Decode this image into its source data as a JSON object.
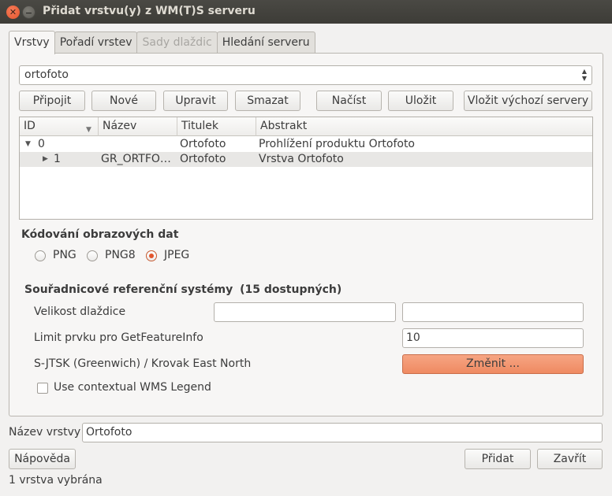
{
  "window": {
    "title": "Přidat vrstvu(y) z WM(T)S serveru"
  },
  "tabs": [
    {
      "label": "Vrstvy",
      "state": "active"
    },
    {
      "label": "Pořadí vrstev",
      "state": "normal"
    },
    {
      "label": "Sady dlaždic",
      "state": "disabled"
    },
    {
      "label": "Hledání serveru",
      "state": "normal"
    }
  ],
  "connection": {
    "selected": "ortofoto"
  },
  "connection_buttons": {
    "connect": "Připojit",
    "new": "Nové",
    "edit": "Upravit",
    "delete": "Smazat",
    "load": "Načíst",
    "save": "Uložit",
    "add_default": "Vložit výchozí servery"
  },
  "layer_table": {
    "columns": [
      "ID",
      "Název",
      "Titulek",
      "Abstrakt"
    ],
    "rows": [
      {
        "id": "0",
        "name": "",
        "title": "Ortofoto",
        "abstract": "Prohlížení produktu Ortofoto"
      },
      {
        "id": "1",
        "name": "GR_ORTFO…",
        "title": "Ortofoto",
        "abstract": "Vrstva Ortofoto"
      }
    ]
  },
  "encoding": {
    "heading": "Kódování obrazových dat",
    "options": [
      "PNG",
      "PNG8",
      "JPEG"
    ],
    "selected": "JPEG"
  },
  "crs": {
    "heading": "Souřadnicové referenční systémy",
    "count_text": "(15 dostupných)",
    "tile_size_label": "Velikost dlaždice",
    "tile_width": "",
    "tile_height": "",
    "feature_limit_label": "Limit prvku pro GetFeatureInfo",
    "feature_limit": "10",
    "current_crs": "S-JTSK (Greenwich) / Krovak East North",
    "change_button": "Změnit ...",
    "contextual_legend_label": "Use contextual WMS Legend",
    "contextual_legend_checked": false
  },
  "layer_name": {
    "label": "Název vrstvy",
    "value": "Ortofoto"
  },
  "footer": {
    "help": "Nápověda",
    "add": "Přidat",
    "close": "Zavřít",
    "status": "1 vrstva vybrána"
  },
  "colors": {
    "titlebar": "#3d3c37",
    "accent": "#e2552d",
    "selection": "#e8e7e5"
  }
}
